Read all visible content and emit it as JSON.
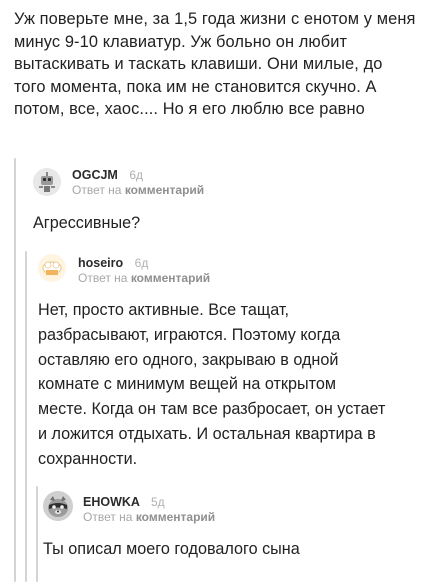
{
  "root_comment": {
    "text": "Уж поверьте мне, за 1,5 года жизни с енотом у меня минус 9-10 клавиатур. Уж больно он любит вытаскивать и таскать клавиши. Они милые, до того момента, пока им не становится скучно. А потом, все, хаос.... Но я его люблю все равно"
  },
  "comments": [
    {
      "author": "OGCJM",
      "time": "6д",
      "reply_prefix": "Ответ на",
      "reply_target": "комментарий",
      "text": "Агрессивные?",
      "avatar_icon": "robot-avatar-icon"
    },
    {
      "author": "hoseiro",
      "time": "6д",
      "reply_prefix": "Ответ на",
      "reply_target": "комментарий",
      "text": "Нет, просто активные. Все тащат, разбрасывают, играются. Поэтому когда оставляю его одного, закрываю в одной комнате с минимум вещей на открытом месте. Когда он там все разбросает, он устает и ложится отдыхать. И остальная квартира в сохранности.",
      "avatar_icon": "chef-hat-avatar-icon"
    },
    {
      "author": "EHOWKA",
      "time": "5д",
      "reply_prefix": "Ответ на",
      "reply_target": "комментарий",
      "text": "Ты описал моего годовалого сына",
      "avatar_icon": "raccoon-avatar-icon"
    }
  ],
  "colors": {
    "text": "#222222",
    "meta": "#a7a7a7",
    "thread_line": "#d4d4d4"
  }
}
